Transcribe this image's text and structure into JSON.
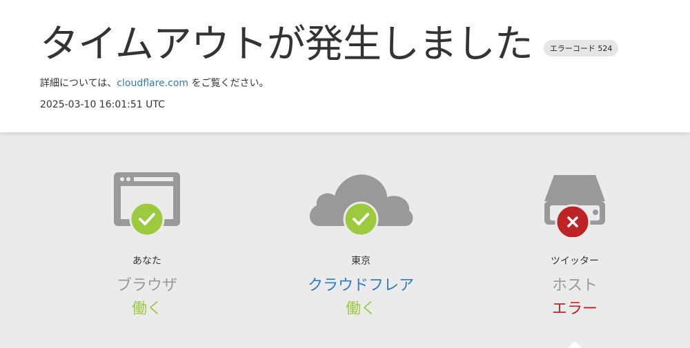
{
  "header": {
    "title": "タイムアウトが発生しました",
    "error_badge": "エラーコード 524",
    "detail_prefix": "詳細については、",
    "detail_link": "cloudflare.com",
    "detail_suffix": " をご覧ください。",
    "timestamp": "2025-03-10 16:01:51 UTC"
  },
  "nodes": [
    {
      "location": "あなた",
      "service": "ブラウザ",
      "status": "働く",
      "state": "ok",
      "icon": "browser-icon"
    },
    {
      "location": "東京",
      "service": "クラウドフレア",
      "status": "働く",
      "state": "ok",
      "icon": "cloud-icon"
    },
    {
      "location": "ツイッター",
      "service": "ホスト",
      "status": "エラー",
      "state": "error",
      "icon": "server-icon"
    }
  ],
  "colors": {
    "ok": "#9bca3e",
    "error": "#bd2426",
    "link": "#2f7bbf",
    "icon_gray": "#999999"
  }
}
